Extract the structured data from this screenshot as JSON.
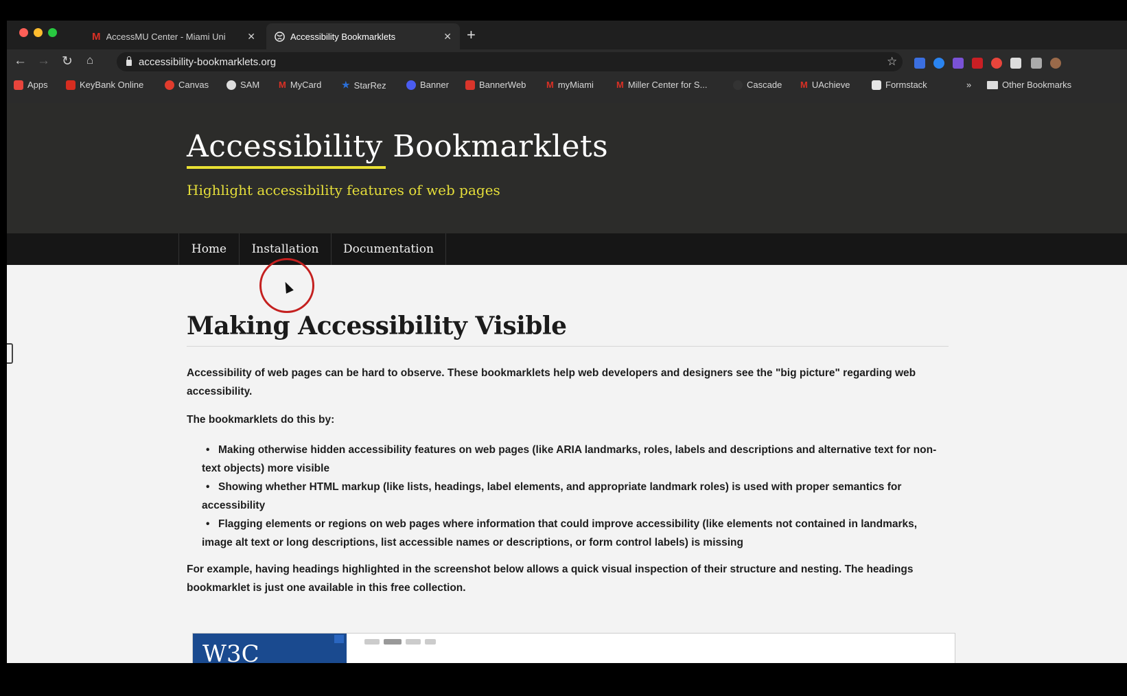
{
  "tabs": [
    {
      "label": "AccessMU Center - Miami Uni",
      "icon": "gmail-icon"
    },
    {
      "label": "Accessibility Bookmarklets",
      "icon": "globe-icon"
    }
  ],
  "address_bar": {
    "url": "accessibility-bookmarklets.org"
  },
  "bookmarks": [
    {
      "label": "Apps",
      "color": "#e8453c"
    },
    {
      "label": "KeyBank Online",
      "color": "#d62d20"
    },
    {
      "label": "Canvas",
      "color": "#e13c2d"
    },
    {
      "label": "SAM",
      "color": "#dddddd"
    },
    {
      "label": "MyCard",
      "color": "#c91f24"
    },
    {
      "label": "StarRez",
      "color": "#2a6fd8"
    },
    {
      "label": "Banner",
      "color": "#4a5cf0"
    },
    {
      "label": "BannerWeb",
      "color": "#d9352b"
    },
    {
      "label": "myMiami",
      "color": "#c91f24"
    },
    {
      "label": "Miller Center for S...",
      "color": "#c91f24"
    },
    {
      "label": "Cascade",
      "color": "#333333"
    },
    {
      "label": "UAchieve",
      "color": "#c91f24"
    },
    {
      "label": "Formstack",
      "color": "#e5e5e5"
    },
    {
      "label": "»",
      "color": "#2b2b2b"
    },
    {
      "label": "Other Bookmarks",
      "color": "#dddddd"
    }
  ],
  "site": {
    "title": "Accessibility Bookmarklets",
    "tagline": "Highlight accessibility features of web pages",
    "nav": [
      "Home",
      "Installation",
      "Documentation"
    ]
  },
  "main": {
    "heading": "Making Accessibility Visible",
    "intro": "Accessibility of web pages can be hard to observe. These bookmarklets help web developers and designers see the \"big picture\" regarding web accessibility.",
    "lead": "The bookmarklets do this by:",
    "bullets": [
      "Making otherwise hidden accessibility features on web pages (like ARIA landmarks, roles, labels and descriptions and alternative text for non-text objects) more visible",
      "Showing whether HTML markup (like lists, headings, label elements, and appropriate landmark roles) is used with proper semantics for accessibility",
      "Flagging elements or regions on web pages where information that could improve accessibility (like elements not contained in landmarks, image alt text or long descriptions, list accessible names or descriptions, or form control labels) is missing"
    ],
    "example": "For example, having headings highlighted in the screenshot below allows a quick visual inspection of their structure and nesting. The headings bookmarklet is just one available in this free collection.",
    "screenshot_logo": "W3C"
  },
  "colors": {
    "header_bg": "#2c2c2a",
    "accent_yellow": "#e9e033",
    "nav_bg": "#161616",
    "content_bg": "#f3f3f3",
    "cursor_ring": "#c4201f"
  }
}
